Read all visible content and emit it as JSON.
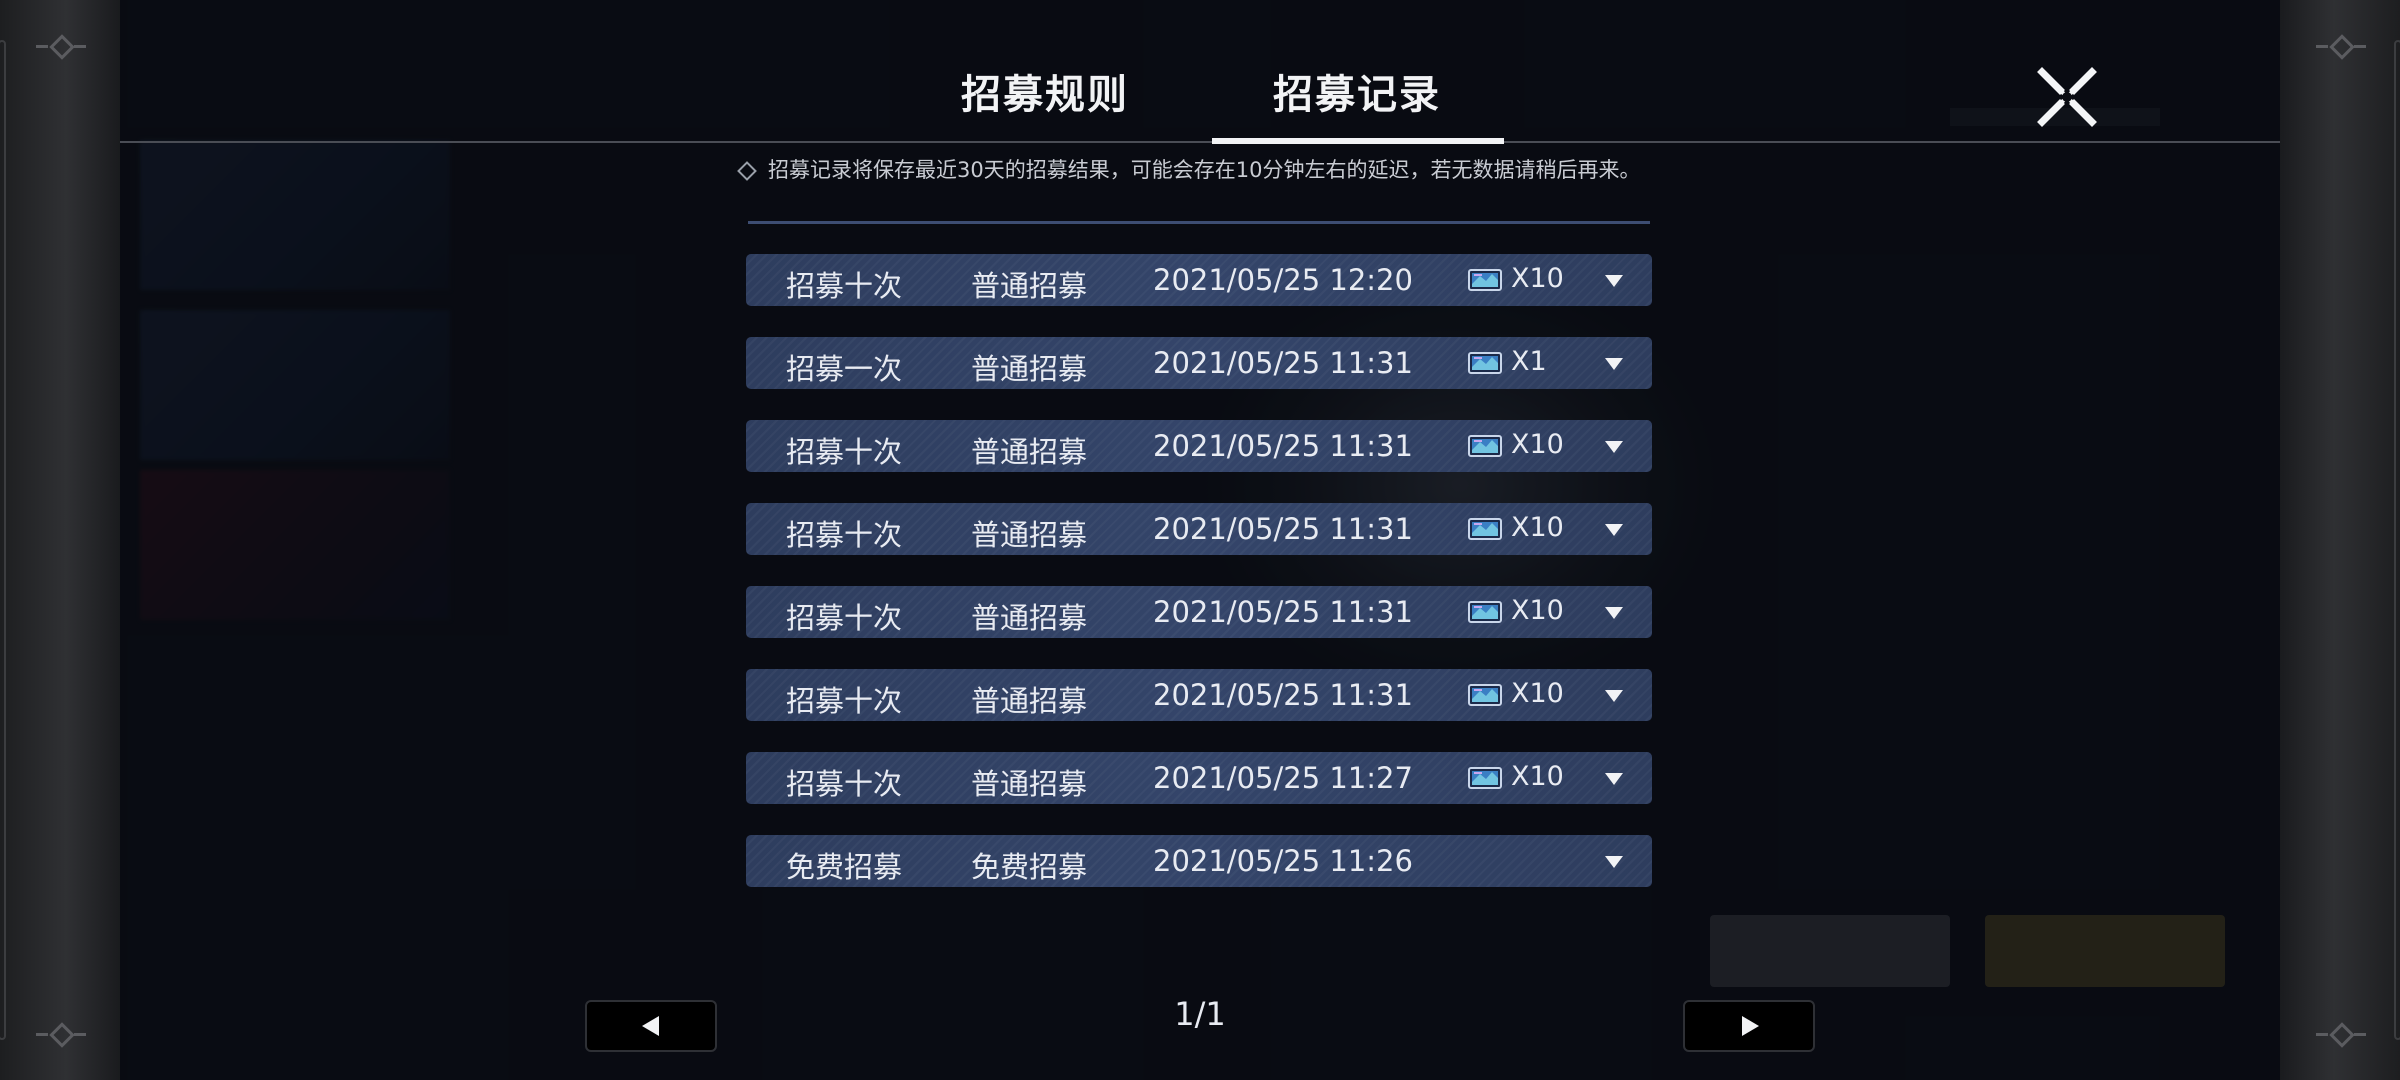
{
  "tabs": {
    "rules_label": "招募规则",
    "records_label": "招募记录",
    "active": "records"
  },
  "notice": {
    "text": "招募记录将保存最近30天的招募结果，可能会存在10分钟左右的延迟，若无数据请稍后再来。"
  },
  "records": [
    {
      "type": "招募十次",
      "pool": "普通招募",
      "time": "2021/05/25 12:20",
      "has_ticket": true,
      "qty": "X10"
    },
    {
      "type": "招募一次",
      "pool": "普通招募",
      "time": "2021/05/25 11:31",
      "has_ticket": true,
      "qty": "X1"
    },
    {
      "type": "招募十次",
      "pool": "普通招募",
      "time": "2021/05/25 11:31",
      "has_ticket": true,
      "qty": "X10"
    },
    {
      "type": "招募十次",
      "pool": "普通招募",
      "time": "2021/05/25 11:31",
      "has_ticket": true,
      "qty": "X10"
    },
    {
      "type": "招募十次",
      "pool": "普通招募",
      "time": "2021/05/25 11:31",
      "has_ticket": true,
      "qty": "X10"
    },
    {
      "type": "招募十次",
      "pool": "普通招募",
      "time": "2021/05/25 11:31",
      "has_ticket": true,
      "qty": "X10"
    },
    {
      "type": "招募十次",
      "pool": "普通招募",
      "time": "2021/05/25 11:27",
      "has_ticket": true,
      "qty": "X10"
    },
    {
      "type": "免费招募",
      "pool": "免费招募",
      "time": "2021/05/25 11:26",
      "has_ticket": false,
      "qty": ""
    }
  ],
  "pagination": {
    "indicator": "1/1"
  },
  "icons": {
    "close": "close-x-icon",
    "ticket": "recruit-ticket-icon",
    "expand": "triangle-down-icon",
    "prev": "triangle-left-icon",
    "next": "triangle-right-icon"
  },
  "colors": {
    "row_bg": "#34456a",
    "accent_line": "#3d4d72",
    "tab_active": "#f2f3f5"
  }
}
